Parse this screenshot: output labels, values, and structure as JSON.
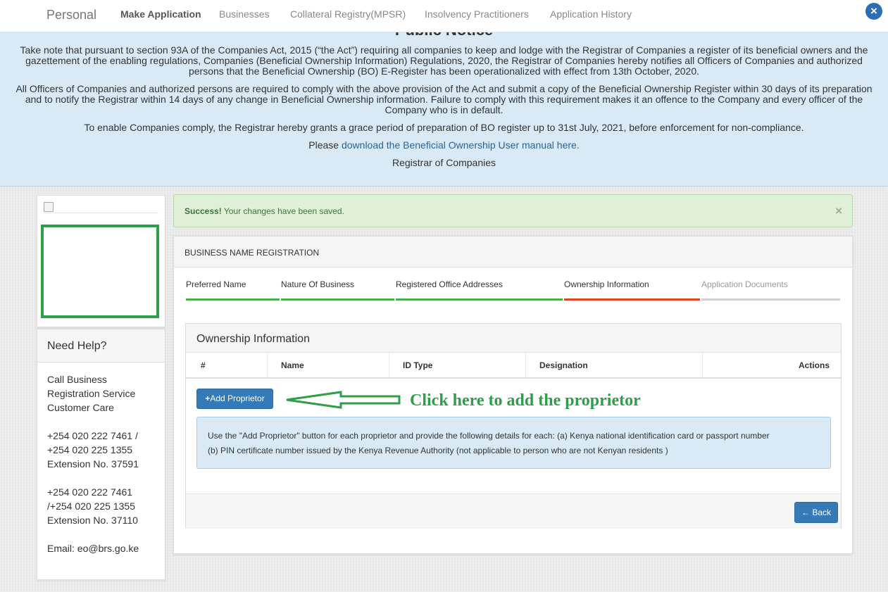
{
  "nav": {
    "brand": "Personal",
    "items": [
      "Make Application",
      "Businesses",
      "Collateral Registry(MPSR)",
      "Insolvency Practitioners",
      "Application History"
    ],
    "close_icon": "×"
  },
  "notice": {
    "title": "Public Notice",
    "p1": "Take note that pursuant to section 93A of the Companies Act, 2015 (“the Act”) requiring all companies to keep and lodge with the Registrar of Companies a register of its beneficial owners and the gazettement of the enabling regulations, Companies (Beneficial Ownership Information) Regulations, 2020, the Registrar of Companies hereby notifies all Officers of Companies and authorized persons that the Beneficial Ownership (BO) E-Register has been operationalized with effect from 13th October, 2020.",
    "p2": "All Officers of Companies and authorized persons are required to comply with the above provision of the Act and submit a copy of the Beneficial Ownership Register within 30 days of its preparation and to notify the Registrar within 14 days of any change in Beneficial Ownership information. Failure to comply with this requirement makes it an offence to the Company and every officer of the Company who is in default.",
    "p3": "To enable Companies comply, the Registrar hereby grants a grace period of preparation of BO register up to 31st July, 2021, before enforcement for non-compliance.",
    "p4_prefix": "Please",
    "p4_link": "download the Beneficial Ownership User manual here.",
    "signature": "Registrar of Companies"
  },
  "sidebar": {
    "help_title": "Need Help?",
    "contact_1": [
      "Call Business",
      "Registration Service",
      "Customer Care"
    ],
    "contact_2": [
      "+254 020 222 7461 /",
      "+254 020 225 1355",
      "Extension No. 37591"
    ],
    "contact_3": [
      "+254 020 222 7461",
      "/+254 020 225 1355",
      "Extension No. 37110"
    ],
    "email": "Email: eo@brs.go.ke"
  },
  "alert": {
    "strong": "Success!",
    "message": " Your changes have been saved.",
    "close": "×"
  },
  "panel": {
    "title": "BUSINESS NAME REGISTRATION",
    "steps": [
      {
        "label": "Preferred Name",
        "state": "done"
      },
      {
        "label": "Nature Of Business",
        "state": "done"
      },
      {
        "label": "Registered Office Addresses",
        "state": "done"
      },
      {
        "label": "Ownership Information",
        "state": "current"
      },
      {
        "label": "Application Documents",
        "state": "pending"
      }
    ],
    "colors": {
      "done": "#4cae4c",
      "current": "#e0451c",
      "pending": "#d0d0d0"
    }
  },
  "ownership": {
    "title": "Ownership Information",
    "columns": [
      "#",
      "Name",
      "ID Type",
      "Designation",
      "Actions"
    ],
    "add_button": "Add Proprietor",
    "add_icon": "+",
    "callout": "Click here to add the proprietor",
    "info_line1": "Use the \"Add Proprietor\" button for each proprietor and provide the following details for each: (a) Kenya national identification card or passport number",
    "info_line2": "(b) PIN certificate number issued by the Kenya Revenue Authority (not applicable to person who are not Kenyan residents )",
    "back_button": "Back",
    "back_icon": "←"
  }
}
